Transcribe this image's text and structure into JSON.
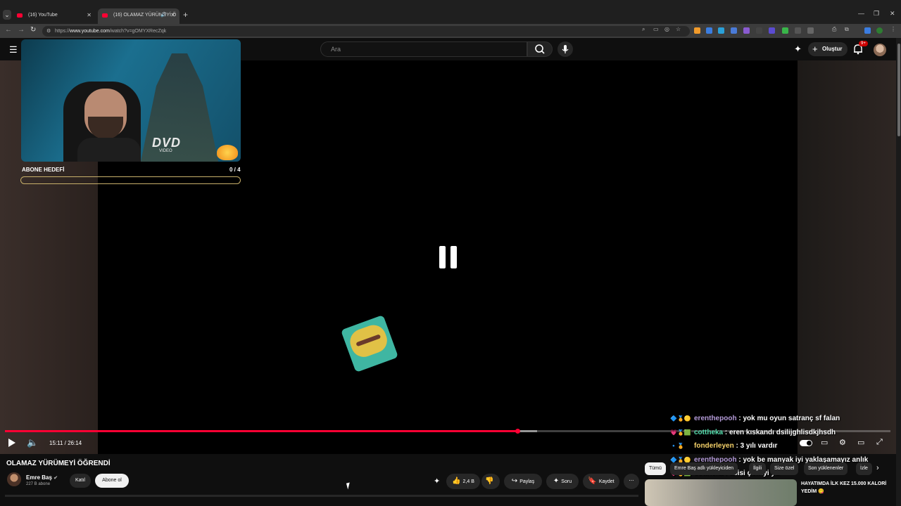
{
  "browser": {
    "tabs": [
      {
        "label": "(16) YouTube"
      },
      {
        "label": "(16) OLAMAZ YÜRÜMEYİ Ö"
      }
    ],
    "url_prefix": "https://",
    "url_host": "www.youtube.com",
    "url_path": "/watch?v=gOMYXRecZqk"
  },
  "masthead": {
    "search_placeholder": "Ara",
    "create_label": "Oluştur",
    "notifications_badge": "9+"
  },
  "overlay": {
    "goal_label": "ABONE HEDEFİ",
    "goal_count": "0 / 4",
    "goal_progress": 0,
    "dvd_text": "DVD",
    "dvd_sub": "VIDEO"
  },
  "player": {
    "time": "15:11 / 26:14",
    "progress_fraction": 0.579,
    "buffer_fraction": 0.601,
    "state": "paused",
    "accent_color": "#ff0033"
  },
  "chat": [
    {
      "user": "erenthepooh",
      "message": ": yok mu oyun satranç sf falan"
    },
    {
      "user": "cottheka",
      "message": ": eren kıskandı dsilijghlisdkjhsdh"
    },
    {
      "user": "fonderleyen",
      "message": ": 3 yılı vardır"
    },
    {
      "user": "erenthepooh",
      "message": ": yok be manyak iyi yaklaşamayız anlık"
    },
    {
      "user": "cottheka",
      "message": ": abisi çok iyi ya"
    },
    {
      "user": "erenthepooh",
      "message": ":"
    }
  ],
  "video": {
    "title": "OLAMAZ YÜRÜMEYİ ÖĞRENDİ",
    "channel": "Emre Baş",
    "subscribers": "227 B abone",
    "join_label": "Katıl",
    "subscribe_label": "Abone ol",
    "likes": "2,4 B",
    "share_label": "Paylaş",
    "ask_label": "Soru",
    "save_label": "Kaydet"
  },
  "filters": {
    "chips": [
      "Tümü",
      "Emre Baş adlı yükleyiciden",
      "İlgili",
      "Size özel",
      "Son yüklenenler",
      "İzle"
    ]
  },
  "recommendation": {
    "title": "HAYATIMDA İLK KEZ 15.000 KALORİ YEDİM 😋"
  }
}
